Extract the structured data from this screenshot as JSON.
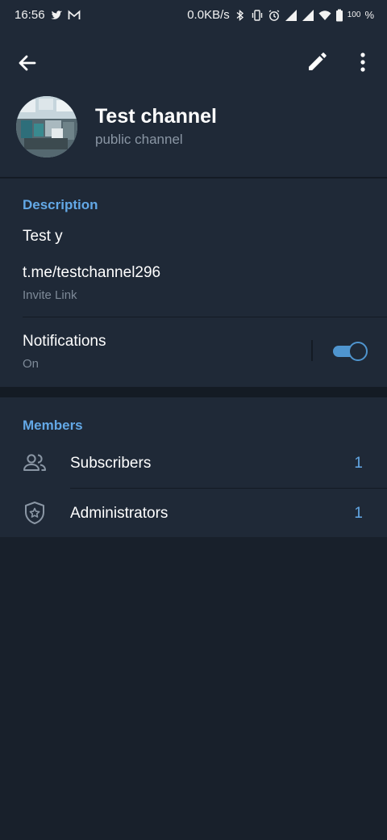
{
  "status_bar": {
    "time": "16:56",
    "network_speed": "0.0KB/s",
    "battery": "100",
    "percent_sign": "%",
    "icons": [
      "twitter-icon",
      "gmail-icon",
      "bluetooth-icon",
      "vibrate-icon",
      "alarm-icon",
      "signal-icon",
      "signal-icon",
      "wifi-icon",
      "battery-icon"
    ]
  },
  "toolbar": {
    "back_icon": "arrow-left-icon",
    "edit_icon": "pencil-icon",
    "more_icon": "more-vert-icon"
  },
  "channel": {
    "title": "Test channel",
    "subtitle": "public channel"
  },
  "info": {
    "description_header": "Description",
    "description_text": "Test y",
    "invite_link": "t.me/testchannel296",
    "invite_link_label": "Invite Link",
    "notifications_label": "Notifications",
    "notifications_state": "On",
    "notifications_enabled": true
  },
  "members": {
    "header": "Members",
    "rows": [
      {
        "label": "Subscribers",
        "count": "1",
        "icon": "people-icon"
      },
      {
        "label": "Administrators",
        "count": "1",
        "icon": "shield-star-icon"
      }
    ]
  },
  "colors": {
    "accent": "#63a8e6",
    "toggle": "#4f95cf",
    "card_bg": "#1f2937",
    "page_bg": "#18202b"
  }
}
